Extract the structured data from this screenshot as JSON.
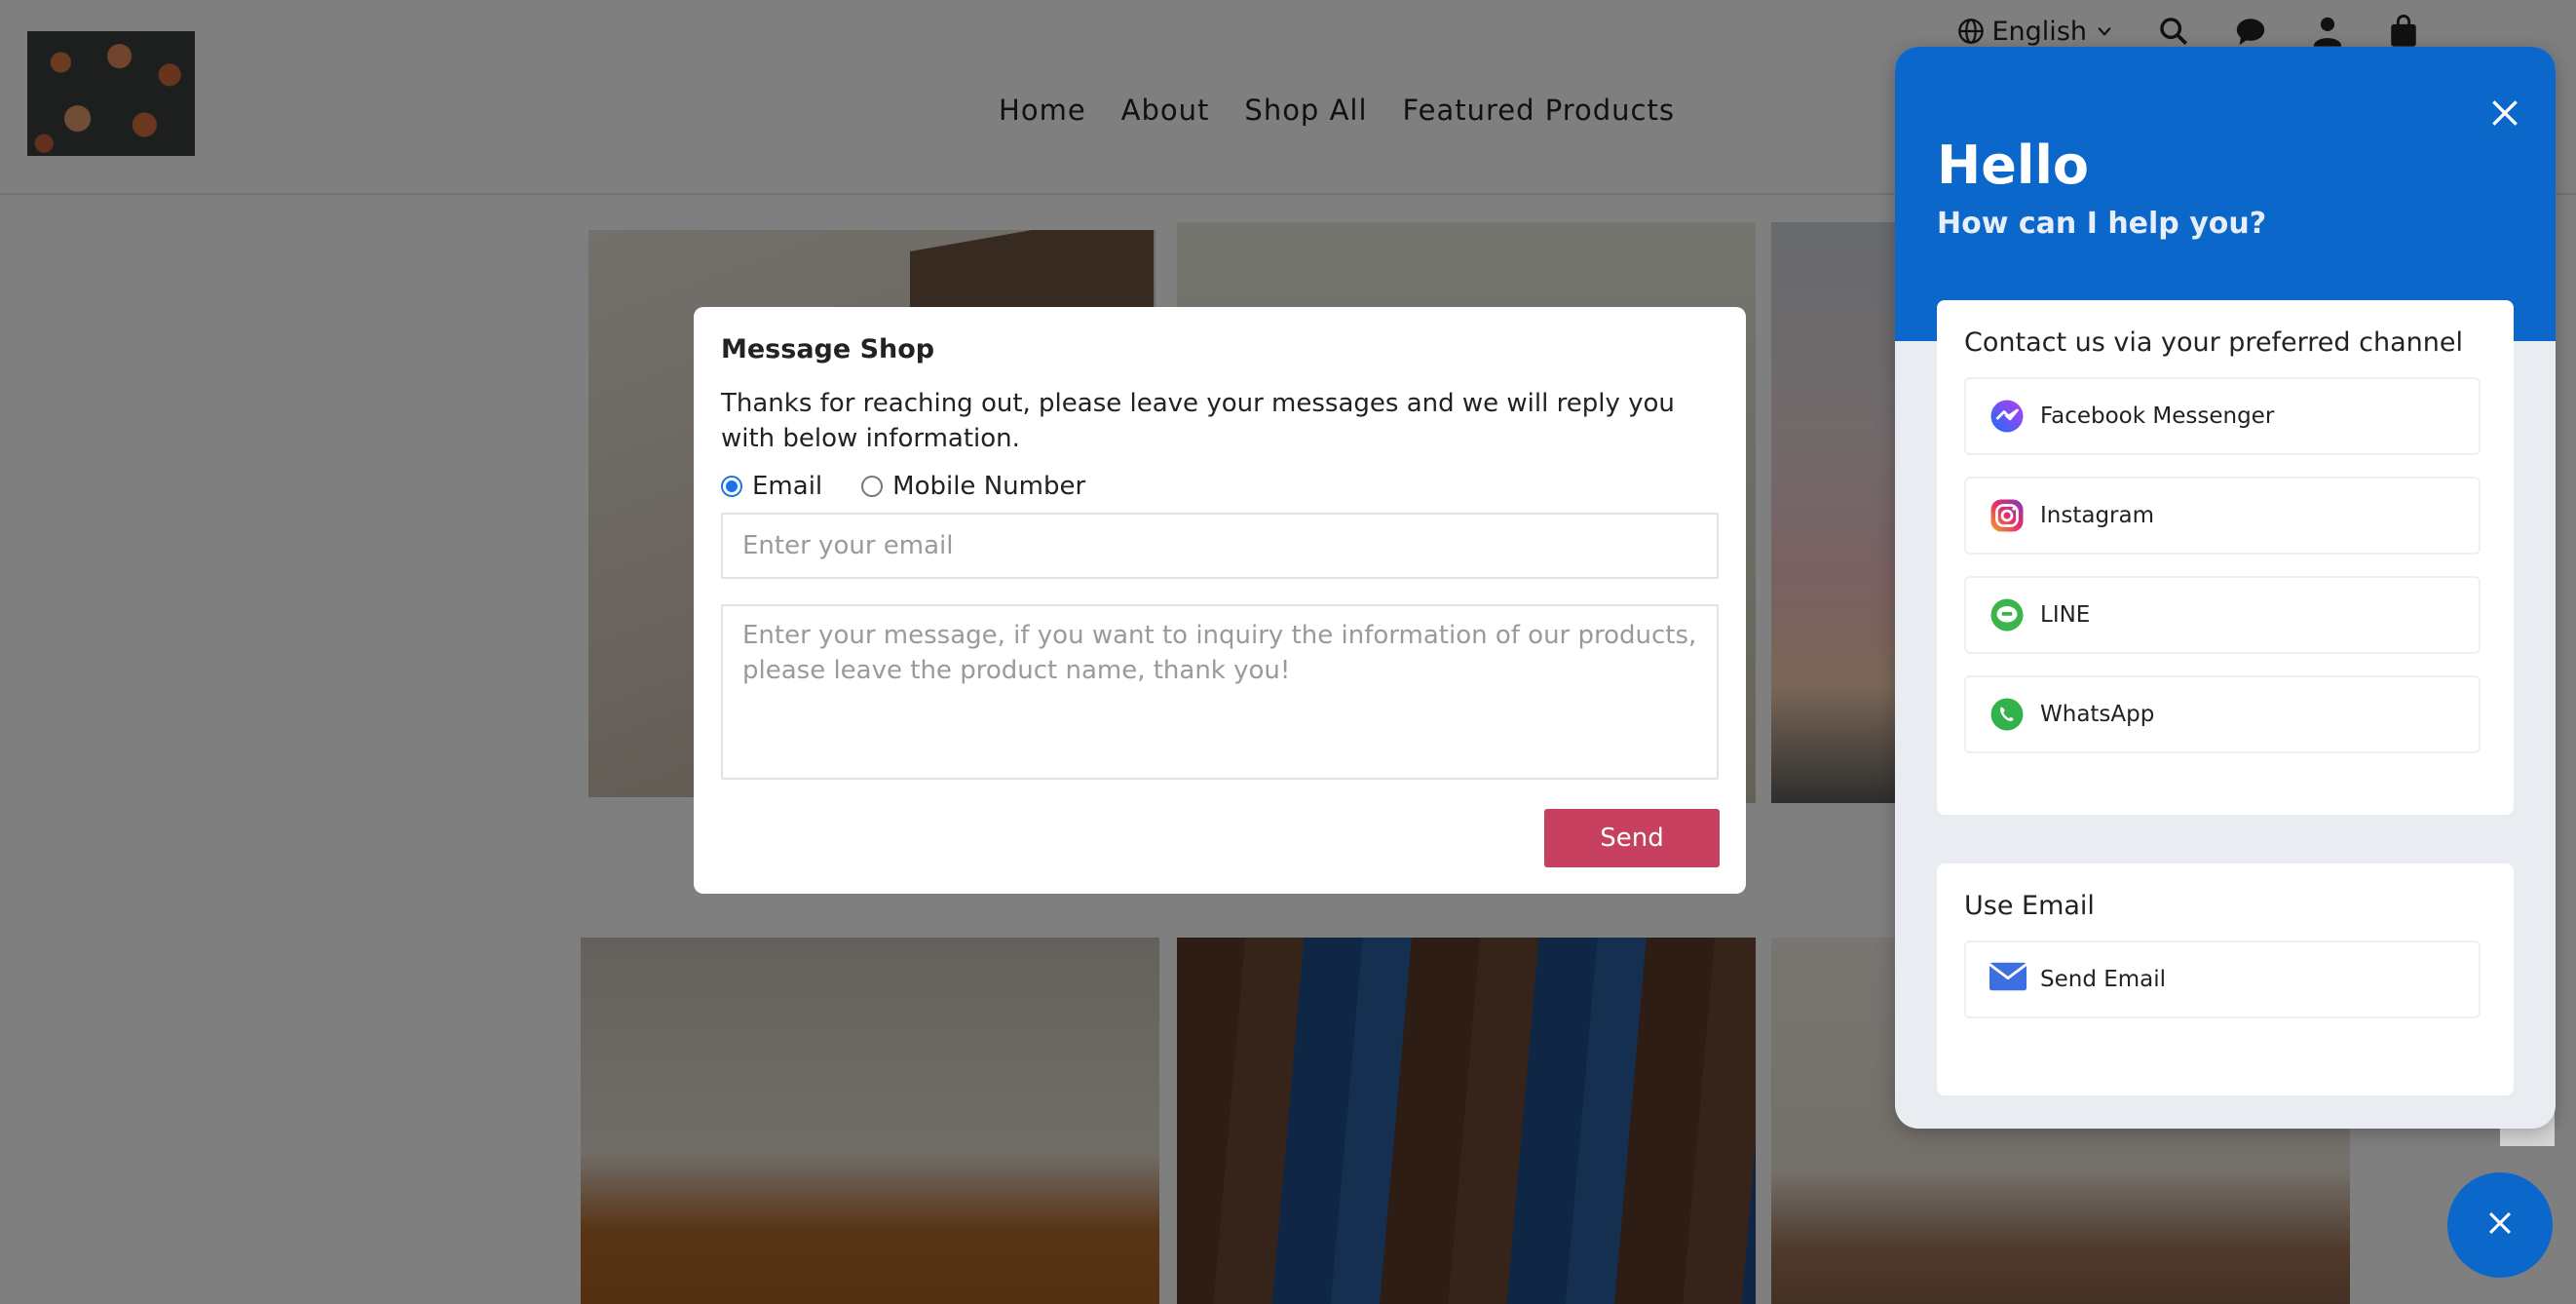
{
  "header": {
    "logo_alt": "",
    "nav": [
      "Home",
      "About",
      "Shop All",
      "Featured Products"
    ],
    "language": "English"
  },
  "icons": {
    "globe": "globe-icon",
    "search": "search-icon",
    "chat": "chat-icon",
    "account": "user-icon",
    "cart": "bag-icon"
  },
  "modal": {
    "title": "Message Shop",
    "description": "Thanks for reaching out, please leave your messages and we will reply you with below information.",
    "radio_email": "Email",
    "radio_mobile": "Mobile Number",
    "selected": "Email",
    "email_placeholder": "Enter your email",
    "message_placeholder": "Enter your message, if you want to inquiry the information of our products, please leave the product name, thank you!",
    "send_label": "Send"
  },
  "chat": {
    "hello": "Hello",
    "help": "How can I help you?",
    "channels_title": "Contact us via your preferred channel",
    "channels": [
      {
        "label": "Facebook Messenger",
        "icon": "messenger-icon"
      },
      {
        "label": "Instagram",
        "icon": "instagram-icon"
      },
      {
        "label": "LINE",
        "icon": "line-icon"
      },
      {
        "label": "WhatsApp",
        "icon": "whatsapp-icon"
      }
    ],
    "email_title": "Use Email",
    "email_button": "Send Email"
  },
  "colors": {
    "accent": "#0b67c9",
    "send": "#c8405f"
  }
}
